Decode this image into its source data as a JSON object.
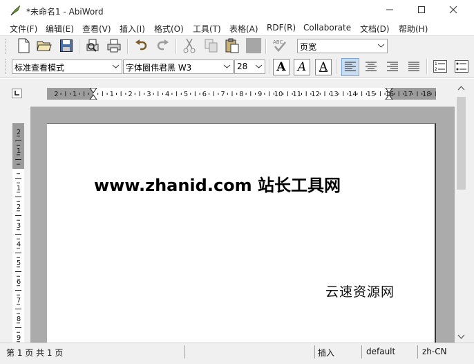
{
  "window": {
    "title": "*未命名1 - AbiWord",
    "icons": {
      "app": "abiword-quill-icon",
      "minimize": "minimize-icon",
      "maximize": "maximize-icon",
      "close": "close-icon"
    }
  },
  "menu": {
    "items": [
      "文件(F)",
      "编辑(E)",
      "查看(V)",
      "插入(I)",
      "格式(O)",
      "工具(T)",
      "表格(A)",
      "RDF(R)",
      "Collaborate",
      "文档(D)",
      "帮助(H)"
    ]
  },
  "toolbar": {
    "icons": [
      "new-document-icon",
      "open-folder-icon",
      "save-icon",
      "print-preview-icon",
      "print-icon",
      "undo-icon",
      "redo-icon",
      "cut-icon",
      "copy-icon",
      "paste-icon",
      "format-painter-icon",
      "spellcheck-icon"
    ],
    "zoom_value": "页宽"
  },
  "format_bar": {
    "style_value": "标准查看模式",
    "font_value": "字体圈伟君黑 W3",
    "size_value": "28",
    "bold_label": "A",
    "italic_label": "A",
    "underline_label": "A",
    "alignment_active": "left",
    "icons": [
      "bold-icon",
      "italic-icon",
      "underline-icon",
      "align-left-icon",
      "align-center-icon",
      "align-right-icon",
      "align-justify-icon",
      "numbered-list-icon",
      "bulleted-list-icon"
    ]
  },
  "ruler": {
    "horizontal_numbers": [
      "2",
      "1",
      "1",
      "2",
      "3",
      "4",
      "5",
      "6",
      "7",
      "8",
      "9",
      "10",
      "11",
      "12",
      "13",
      "14",
      "15",
      "16",
      "17",
      "18"
    ],
    "vertical_numbers": [
      "2",
      "1",
      "1",
      "2",
      "3",
      "4",
      "5",
      "6",
      "7",
      "8",
      "9"
    ]
  },
  "document": {
    "heading": "www.zhanid.com 站长工具网",
    "subtext": "云速资源网"
  },
  "status": {
    "page_info": "第 1 页 共 1 页",
    "mode": "插入",
    "style": "default",
    "language": "zh-CN"
  },
  "colors": {
    "canvas_gray": "#ababab",
    "chrome": "#f0f0f0",
    "active_align": "#c9ddf2"
  }
}
